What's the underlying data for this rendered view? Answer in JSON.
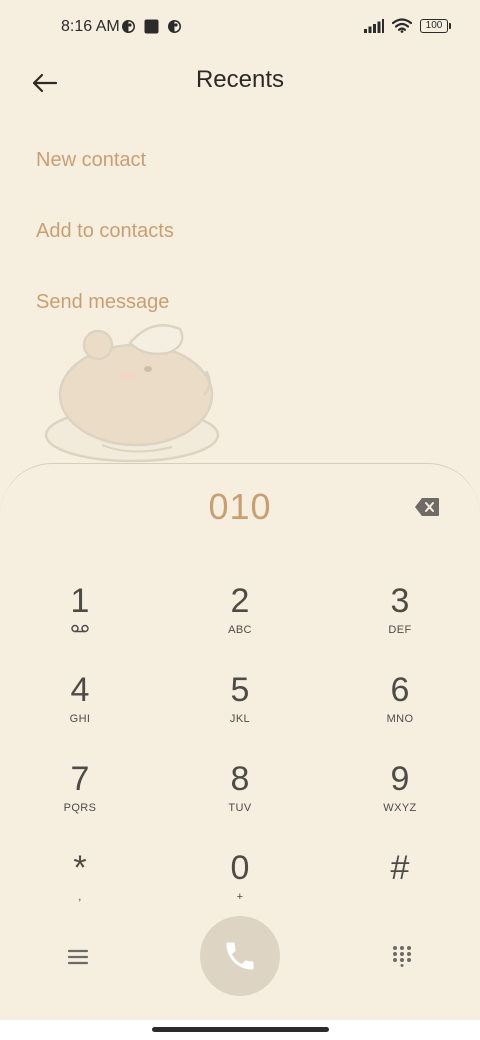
{
  "status_bar": {
    "time": "8:16 AM",
    "battery": "100",
    "left_icons": [
      "app-notification-icon",
      "square-notification-icon",
      "app-notification-icon"
    ],
    "right_icons": [
      "signal-icon",
      "wifi-icon",
      "battery-icon"
    ]
  },
  "header": {
    "title": "Recents",
    "back_icon": "arrow-left-icon"
  },
  "actions": [
    "New contact",
    "Add to contacts",
    "Send message"
  ],
  "dialer": {
    "number": "010",
    "backspace_icon": "backspace-icon",
    "keys": [
      {
        "digit": "1",
        "letters": "",
        "sub_icon": "voicemail-icon"
      },
      {
        "digit": "2",
        "letters": "ABC"
      },
      {
        "digit": "3",
        "letters": "DEF"
      },
      {
        "digit": "4",
        "letters": "GHI"
      },
      {
        "digit": "5",
        "letters": "JKL"
      },
      {
        "digit": "6",
        "letters": "MNO"
      },
      {
        "digit": "7",
        "letters": "PQRS"
      },
      {
        "digit": "8",
        "letters": "TUV"
      },
      {
        "digit": "9",
        "letters": "WXYZ"
      },
      {
        "digit": "*",
        "letters": ","
      },
      {
        "digit": "0",
        "letters": "+"
      },
      {
        "digit": "#",
        "letters": ""
      }
    ],
    "bottom": {
      "menu_icon": "menu-icon",
      "call_icon": "phone-icon",
      "keypad_icon": "dialpad-icon"
    }
  },
  "colors": {
    "background": "#f6efe0",
    "accent": "#c99f72",
    "text": "#4e4b46",
    "call_button": "#ddd4c3"
  }
}
